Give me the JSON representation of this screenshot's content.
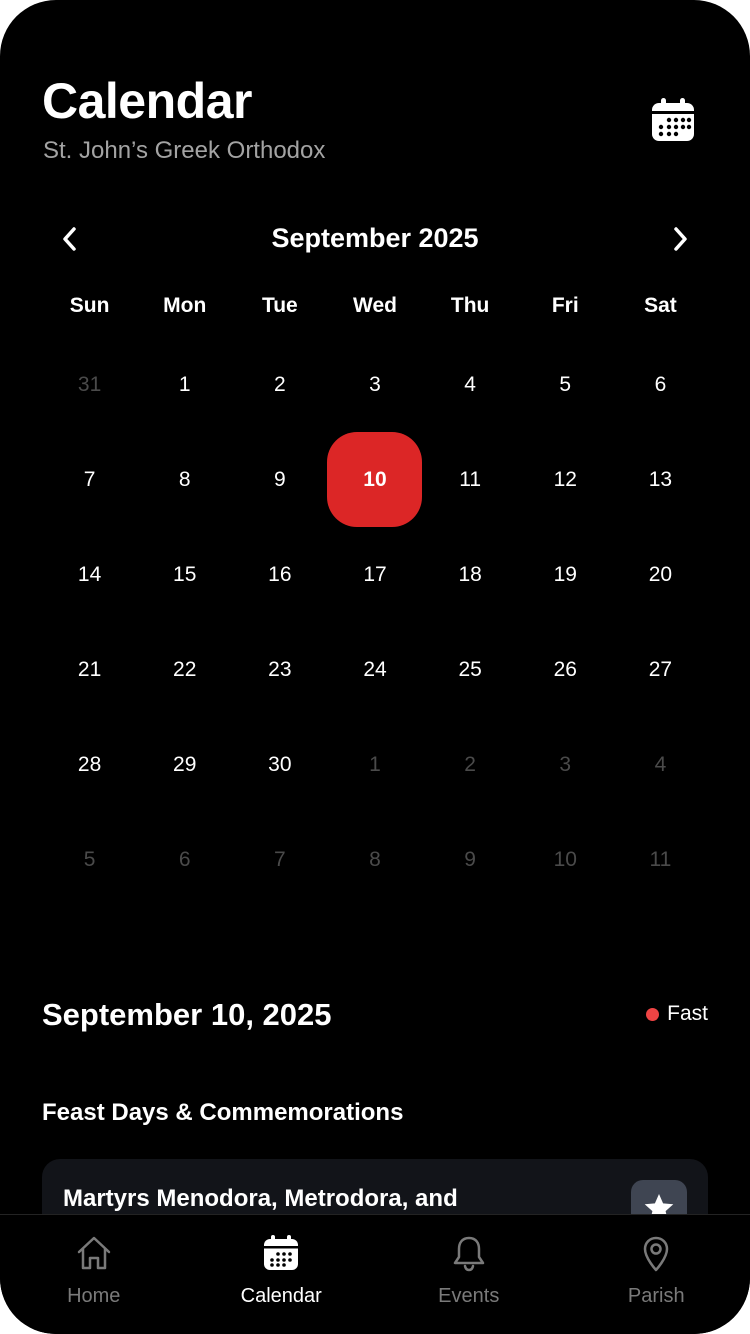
{
  "header": {
    "title": "Calendar",
    "subtitle": "St. John’s Greek Orthodox"
  },
  "month_nav": {
    "label": "September 2025"
  },
  "weekdays": [
    "Sun",
    "Mon",
    "Tue",
    "Wed",
    "Thu",
    "Fri",
    "Sat"
  ],
  "days": [
    {
      "label": "31",
      "muted": true
    },
    {
      "label": "1"
    },
    {
      "label": "2"
    },
    {
      "label": "3"
    },
    {
      "label": "4"
    },
    {
      "label": "5"
    },
    {
      "label": "6"
    },
    {
      "label": "7"
    },
    {
      "label": "8"
    },
    {
      "label": "9"
    },
    {
      "label": "10",
      "selected": true
    },
    {
      "label": "11"
    },
    {
      "label": "12"
    },
    {
      "label": "13"
    },
    {
      "label": "14"
    },
    {
      "label": "15"
    },
    {
      "label": "16"
    },
    {
      "label": "17"
    },
    {
      "label": "18"
    },
    {
      "label": "19"
    },
    {
      "label": "20"
    },
    {
      "label": "21"
    },
    {
      "label": "22"
    },
    {
      "label": "23"
    },
    {
      "label": "24"
    },
    {
      "label": "25"
    },
    {
      "label": "26"
    },
    {
      "label": "27"
    },
    {
      "label": "28"
    },
    {
      "label": "29"
    },
    {
      "label": "30"
    },
    {
      "label": "1",
      "muted": true
    },
    {
      "label": "2",
      "muted": true
    },
    {
      "label": "3",
      "muted": true
    },
    {
      "label": "4",
      "muted": true
    },
    {
      "label": "5",
      "muted": true
    },
    {
      "label": "6",
      "muted": true
    },
    {
      "label": "7",
      "muted": true
    },
    {
      "label": "8",
      "muted": true
    },
    {
      "label": "9",
      "muted": true
    },
    {
      "label": "10",
      "muted": true
    },
    {
      "label": "11",
      "muted": true
    }
  ],
  "selected": {
    "date_label": "September 10, 2025",
    "fast_label": "Fast"
  },
  "feasts": {
    "section_title": "Feast Days & Commemorations",
    "items": [
      {
        "name": "Martyrs Menodora, Metrodora, and",
        "icon": "star-icon"
      }
    ]
  },
  "tabs": [
    {
      "label": "Home",
      "icon": "home-icon"
    },
    {
      "label": "Calendar",
      "icon": "calendar-icon",
      "active": true
    },
    {
      "label": "Events",
      "icon": "bell-icon"
    },
    {
      "label": "Parish",
      "icon": "map-pin-icon"
    }
  ],
  "colors": {
    "accent": "#dc2626",
    "fast_dot": "#ef4444",
    "background": "#000000",
    "card": "#121419"
  }
}
